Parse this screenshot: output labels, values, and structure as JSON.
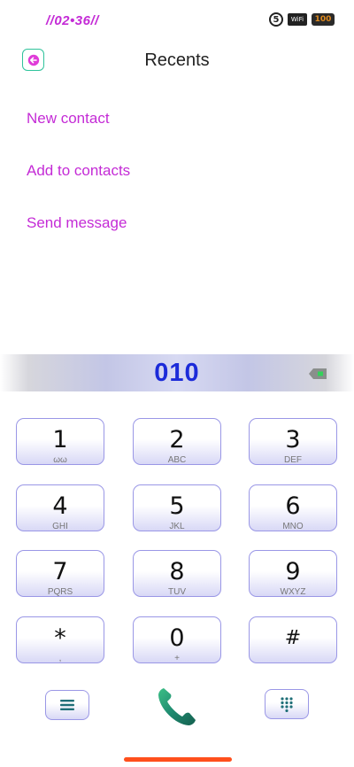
{
  "status_bar": {
    "time": "//02•36//",
    "icons": [
      "sim-5-icon",
      "wifi-icon",
      "battery-icon"
    ],
    "sim_label": "5",
    "wifi_label": "WiFi",
    "battery_label": "100"
  },
  "header": {
    "title": "Recents",
    "back_icon": "arrow-left-icon"
  },
  "menu": {
    "items": [
      {
        "label": "New contact"
      },
      {
        "label": "Add to contacts"
      },
      {
        "label": "Send message"
      }
    ]
  },
  "dialer": {
    "number": "010",
    "backspace_icon": "backspace-icon"
  },
  "keypad": {
    "keys": [
      {
        "digit": "1",
        "letters": "ωω"
      },
      {
        "digit": "2",
        "letters": "ABC"
      },
      {
        "digit": "3",
        "letters": "DEF"
      },
      {
        "digit": "4",
        "letters": "GHI"
      },
      {
        "digit": "5",
        "letters": "JKL"
      },
      {
        "digit": "6",
        "letters": "MNO"
      },
      {
        "digit": "7",
        "letters": "PQRS"
      },
      {
        "digit": "8",
        "letters": "TUV"
      },
      {
        "digit": "9",
        "letters": "WXYZ"
      },
      {
        "digit": "*",
        "letters": ","
      },
      {
        "digit": "0",
        "letters": "+"
      },
      {
        "digit": "#",
        "letters": ""
      }
    ]
  },
  "bottom_bar": {
    "menu_icon": "menu-icon",
    "call_icon": "phone-icon",
    "dialpad_icon": "dialpad-icon"
  },
  "colors": {
    "accent": "#c42bd6",
    "number": "#1c2bd9",
    "key_border": "#9a97e6",
    "call": "#1f8a70",
    "nav_handle": "#ff4f1c"
  }
}
